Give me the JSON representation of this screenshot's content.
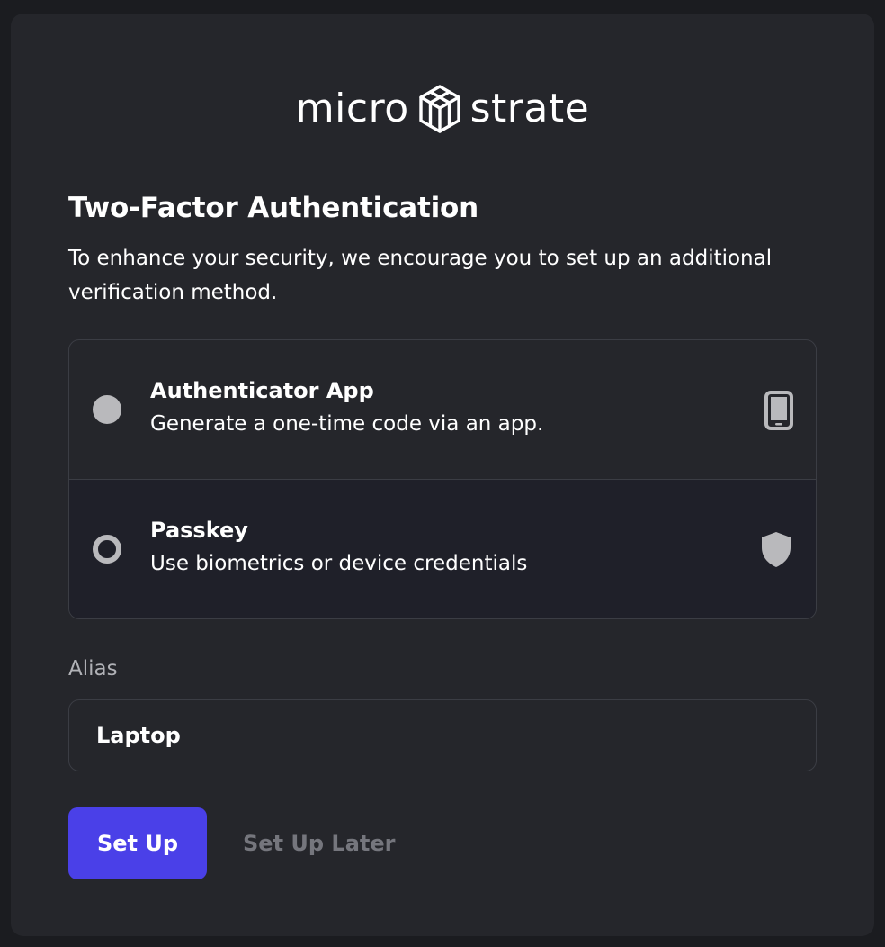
{
  "brand": {
    "word_left": "micro",
    "word_right": "strate",
    "logo_icon": "cube-logo-icon"
  },
  "header": {
    "title": "Two-Factor Authentication",
    "subtitle": "To enhance your security, we encourage you to set up an additional verification method."
  },
  "options": [
    {
      "title": "Authenticator App",
      "description": "Generate a one-time code via an app.",
      "icon": "smartphone-icon",
      "selected": false
    },
    {
      "title": "Passkey",
      "description": "Use biometrics or device credentials",
      "icon": "shield-icon",
      "selected": true
    }
  ],
  "alias": {
    "label": "Alias",
    "value": "Laptop"
  },
  "actions": {
    "primary_label": "Set Up",
    "secondary_label": "Set Up Later"
  },
  "colors": {
    "page_bg": "#1b1c20",
    "card_bg": "#25262b",
    "accent": "#4a40e8",
    "border": "#3b3d44",
    "muted_text": "#75767d"
  }
}
